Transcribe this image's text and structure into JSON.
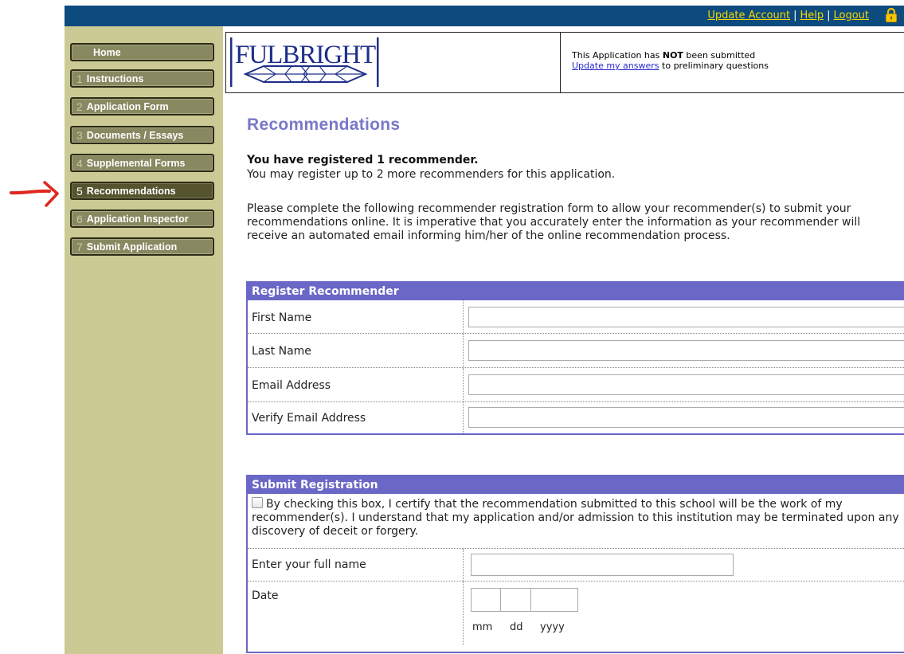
{
  "topbar": {
    "links": [
      "Update Account",
      "Help",
      "Logout"
    ],
    "separator": "|",
    "lock_icon": "lock-icon"
  },
  "sidebar": {
    "items": [
      {
        "num": "",
        "label": "Home"
      },
      {
        "num": "1",
        "label": "Instructions"
      },
      {
        "num": "2",
        "label": "Application Form"
      },
      {
        "num": "3",
        "label": "Documents / Essays"
      },
      {
        "num": "4",
        "label": "Supplemental Forms"
      },
      {
        "num": "5",
        "label": "Recommendations",
        "active": true
      },
      {
        "num": "6",
        "label": "Application Inspector"
      },
      {
        "num": "7",
        "label": "Submit Application"
      }
    ]
  },
  "header": {
    "logo_text": "FULBRIGHT",
    "status_pre": "This Application has ",
    "status_bold": "NOT",
    "status_post": " been submitted",
    "update_link": "Update my answers",
    "update_post": " to preliminary questions"
  },
  "main": {
    "title": "Recommendations",
    "registered": "You have registered 1 recommender.",
    "may_register": "You may register up to 2 more recommenders for this application.",
    "intro": "Please complete the following recommender registration form to allow your recommender(s) to submit your recommendations online. It is imperative that you accurately enter the information as your recommender will receive an automated email informing him/her of the online recommendation process."
  },
  "register_form": {
    "heading": "Register Recommender",
    "fields": [
      {
        "label": "First Name",
        "value": ""
      },
      {
        "label": "Last Name",
        "value": ""
      },
      {
        "label": "Email Address",
        "value": ""
      },
      {
        "label": "Verify Email Address",
        "value": ""
      }
    ]
  },
  "submit_form": {
    "heading": "Submit Registration",
    "certify_text": "By checking this box, I certify that the recommendation submitted to this school will be the work of my recommender(s). I understand that my application and/or admission to this institution may be terminated upon any discovery of deceit or forgery.",
    "certify_checked": false,
    "fullname_label": "Enter your full name",
    "fullname_value": "",
    "date_label": "Date",
    "date_parts": {
      "mm": "mm",
      "dd": "dd",
      "yyyy": "yyyy"
    }
  },
  "colors": {
    "topbar": "#0d4a7e",
    "link_yellow": "#f2d900",
    "sidebar_bg": "#cbca95",
    "nav_button": "#888861",
    "nav_active": "#55542f",
    "panel_header": "#6a67c6",
    "title": "#7a78c8",
    "arrow": "#e0261e"
  }
}
